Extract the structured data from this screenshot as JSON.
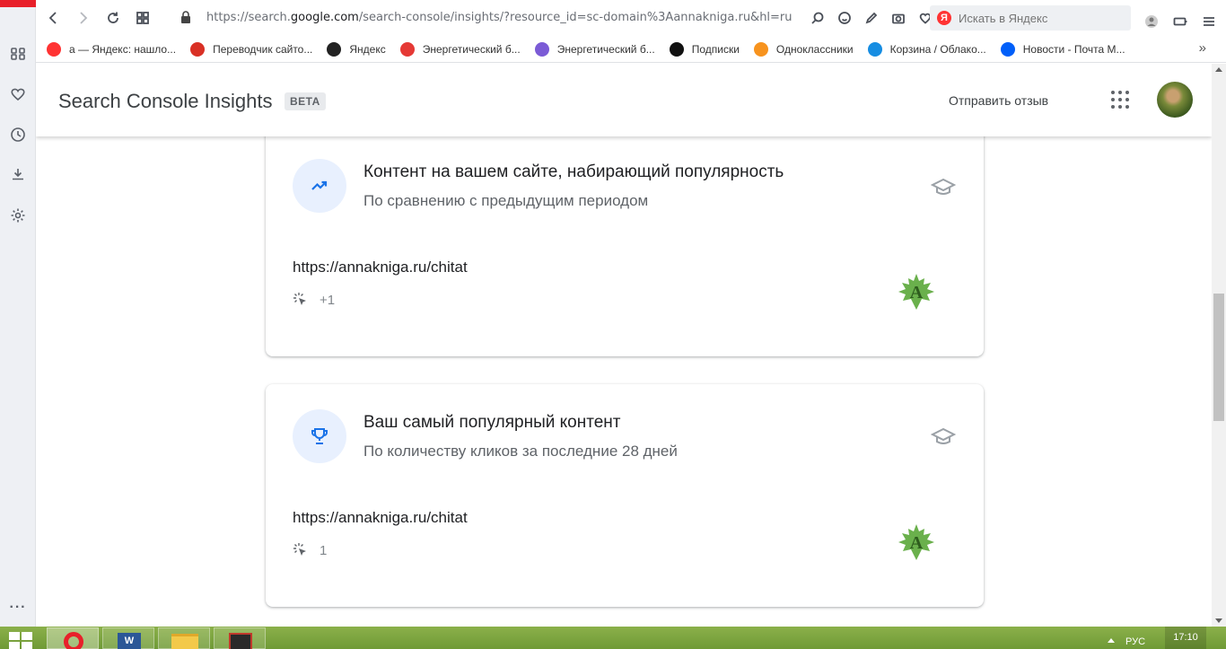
{
  "browser": {
    "url_prefix": "https://search.",
    "url_domain": "google.com",
    "url_rest": "/search-console/insights/?resource_id=sc-domain%3Aannakniga.ru&hl=ru",
    "search_placeholder": "Искать в Яндекс"
  },
  "bookmarks": [
    {
      "label": "а — Яндекс: нашло...",
      "icon": "yandex-icon",
      "color": "#f33"
    },
    {
      "label": "Переводчик сайто...",
      "icon": "translator-icon",
      "color": "#d93025"
    },
    {
      "label": "Яндекс",
      "icon": "yandex-browser-icon",
      "color": "#222"
    },
    {
      "label": "Энергетический б...",
      "icon": "map-pin-icon",
      "color": "#e53935"
    },
    {
      "label": "Энергетический б...",
      "icon": "globe-icon",
      "color": "#7b5bd6"
    },
    {
      "label": "Подписки",
      "icon": "plus-icon",
      "color": "#111"
    },
    {
      "label": "Одноклассники",
      "icon": "ok-icon",
      "color": "#f7931e"
    },
    {
      "label": "Корзина / Облако...",
      "icon": "cloud-icon",
      "color": "#168de2"
    },
    {
      "label": "Новости - Почта М...",
      "icon": "mail-icon",
      "color": "#005ff9"
    }
  ],
  "header": {
    "title": "Search Console Insights",
    "badge": "BETA",
    "feedback": "Отправить отзыв"
  },
  "cards": [
    {
      "title": "Контент на вашем сайте, набирающий популярность",
      "subtitle": "По сравнению с предыдущим периодом",
      "url": "https://annakniga.ru/chitat",
      "clicks": "+1",
      "icon": "trending-up-icon"
    },
    {
      "title": "Ваш самый популярный контент",
      "subtitle": "По количеству кликов за последние 28 дней",
      "url": "https://annakniga.ru/chitat",
      "clicks": "1",
      "icon": "trophy-icon"
    }
  ],
  "taskbar": {
    "lang": "РУС",
    "time": "17:10"
  },
  "colors": {
    "accent": "#1a73e8",
    "icon_bg": "#e8f0fe",
    "opera_red": "#e8202a",
    "leaf_green": "#6ab04c"
  }
}
